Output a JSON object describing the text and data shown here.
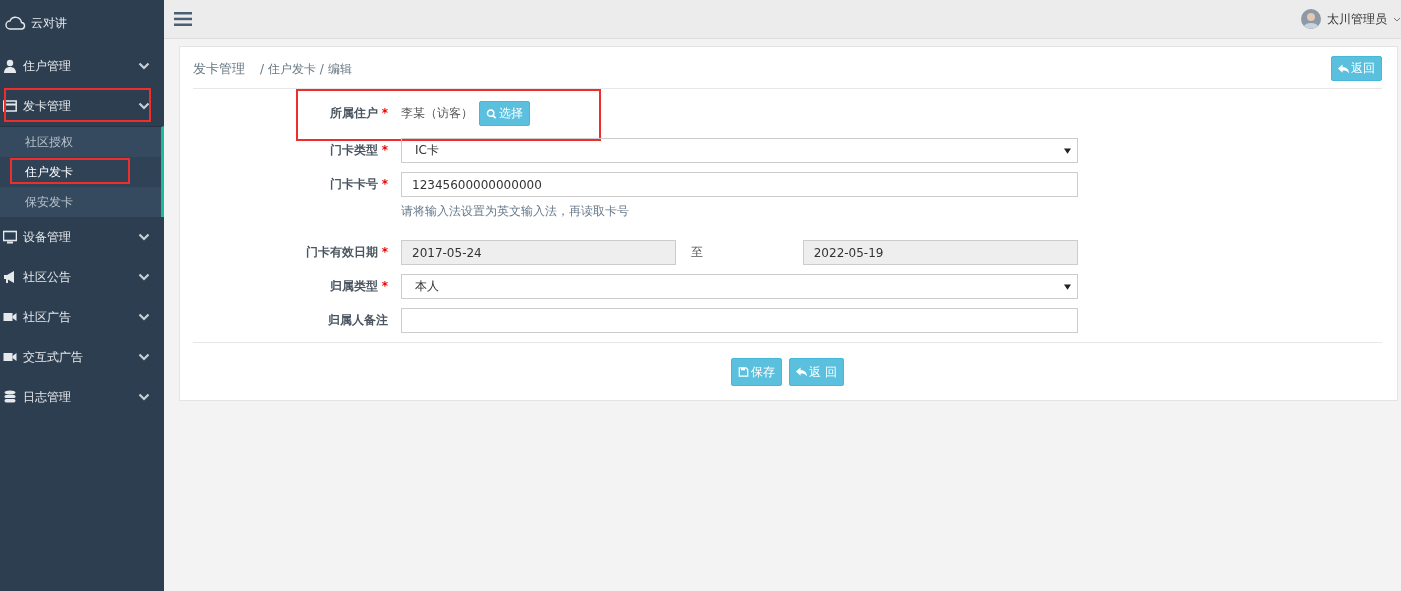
{
  "brand": {
    "name": "云对讲"
  },
  "nav": [
    {
      "label": "住户管理",
      "kind": "user",
      "highlighted": false
    },
    {
      "label": "发卡管理",
      "kind": "card",
      "highlighted": true,
      "children": [
        {
          "label": "社区授权",
          "selected": false,
          "highlighted": false
        },
        {
          "label": "住户发卡",
          "selected": true,
          "highlighted": true
        },
        {
          "label": "保安发卡",
          "selected": false,
          "highlighted": false
        }
      ]
    },
    {
      "label": "设备管理",
      "kind": "monitor",
      "highlighted": false
    },
    {
      "label": "社区公告",
      "kind": "megaphone",
      "highlighted": false
    },
    {
      "label": "社区广告",
      "kind": "video",
      "highlighted": false
    },
    {
      "label": "交互式广告",
      "kind": "video",
      "highlighted": false
    },
    {
      "label": "日志管理",
      "kind": "database",
      "highlighted": false
    }
  ],
  "topbar": {
    "user": "太川管理员"
  },
  "breadcrumb": {
    "title": "发卡管理",
    "path": "/ 住户发卡 / 编辑"
  },
  "back_button": {
    "label": "返回"
  },
  "form": [
    {
      "kind": "picker",
      "label": "所属住户",
      "required_mark": "*",
      "highlighted": true,
      "value": "李某（访客）",
      "button": "选择"
    },
    {
      "kind": "select",
      "label": "门卡类型",
      "required_mark": "*",
      "highlighted": false,
      "value": "IC卡"
    },
    {
      "kind": "text",
      "label": "门卡卡号",
      "required_mark": "*",
      "highlighted": false,
      "value": "12345600000000000",
      "hint": "请将输入法设置为英文输入法，再读取卡号"
    },
    {
      "kind": "daterange",
      "label": "门卡有效日期",
      "required_mark": "*",
      "highlighted": false,
      "from": "2017-05-24",
      "separator": "至",
      "to": "2022-05-19"
    },
    {
      "kind": "select",
      "label": "归属类型",
      "required_mark": "*",
      "highlighted": false,
      "value": "本人"
    },
    {
      "kind": "text",
      "label": "归属人备注",
      "highlighted": false
    }
  ],
  "actions": [
    {
      "label": "保存",
      "kind": "save"
    },
    {
      "label": "返 回",
      "kind": "back"
    }
  ]
}
